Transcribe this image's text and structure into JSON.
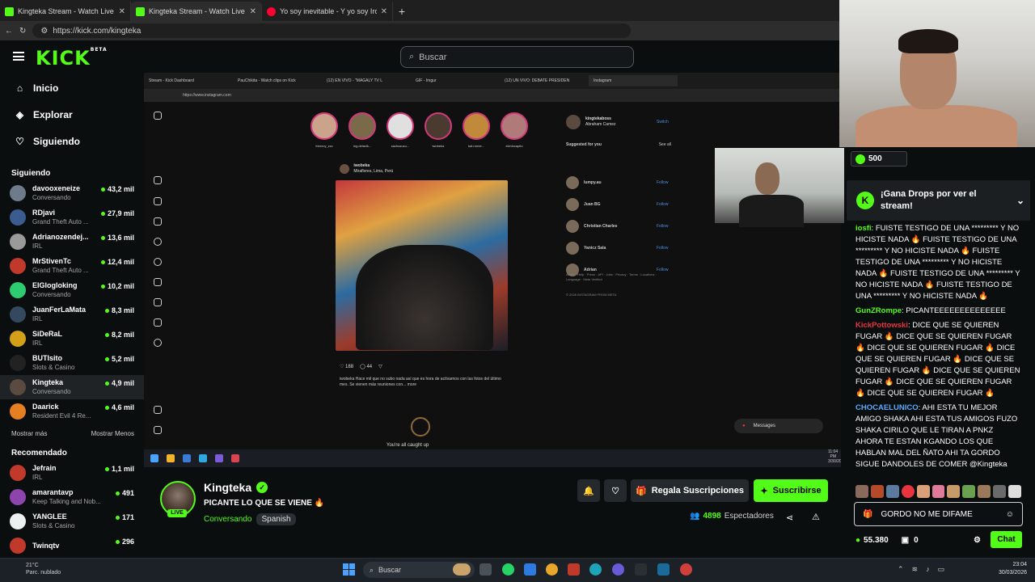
{
  "browser": {
    "tabs": [
      {
        "title": "Kingteka Stream - Watch Live on K",
        "icon": "kick-favicon",
        "color": "#53fc18"
      },
      {
        "title": "Kingteka Stream - Watch Live o",
        "icon": "kick-favicon",
        "color": "#53fc18"
      },
      {
        "title": "Yo soy inevitable - Y yo soy Iron M",
        "icon": "youtube-favicon",
        "color": "#ff0033"
      }
    ],
    "url": "https://kick.com/kingteka"
  },
  "kick": {
    "logo": "KICK",
    "logo_sup": "BETA",
    "search_placeholder": "Buscar",
    "nav": [
      {
        "label": "Inicio",
        "icon": "home-icon"
      },
      {
        "label": "Explorar",
        "icon": "compass-icon"
      },
      {
        "label": "Siguiendo",
        "icon": "heart-icon"
      }
    ],
    "following_header": "Siguiendo",
    "following": [
      {
        "name": "davooxeneize",
        "category": "Conversando",
        "viewers": "43,2 mil",
        "color": "#6f7b8a"
      },
      {
        "name": "RDjavi",
        "category": "Grand Theft Auto ...",
        "viewers": "27,9 mil",
        "color": "#3b5c8f"
      },
      {
        "name": "Adrianozendej...",
        "category": "IRL",
        "viewers": "13,6 mil",
        "color": "#9a9a9a"
      },
      {
        "name": "MrStivenTc",
        "category": "Grand Theft Auto ...",
        "viewers": "12,4 mil",
        "color": "#c0392b"
      },
      {
        "name": "ElGlogloking",
        "category": "Conversando",
        "viewers": "10,2 mil",
        "color": "#2ecc71"
      },
      {
        "name": "JuanFerLaMata",
        "category": "IRL",
        "viewers": "8,3 mil",
        "color": "#34495e"
      },
      {
        "name": "SiDeRaL",
        "category": "IRL",
        "viewers": "8,2 mil",
        "color": "#d4a017"
      },
      {
        "name": "BUTIsito",
        "category": "Slots & Casino",
        "viewers": "5,2 mil",
        "color": "#222"
      },
      {
        "name": "Kingteka",
        "category": "Conversando",
        "viewers": "4,9 mil",
        "color": "#5a4a40"
      },
      {
        "name": "Daarick",
        "category": "Resident Evil 4 Re...",
        "viewers": "4,6 mil",
        "color": "#e67e22"
      }
    ],
    "show_more": "Mostrar más",
    "show_less": "Mostrar Menos",
    "recommended_header": "Recomendado",
    "recommended": [
      {
        "name": "Jefrain",
        "category": "IRL",
        "viewers": "1,1 mil",
        "color": "#c0392b"
      },
      {
        "name": "amarantavp",
        "category": "Keep Talking and Nob...",
        "viewers": "491",
        "color": "#8e44ad"
      },
      {
        "name": "YANGLEE",
        "category": "Slots & Casino",
        "viewers": "171",
        "color": "#ecf0f1"
      },
      {
        "name": "Twinqtv",
        "category": "",
        "viewers": "296",
        "color": "#c0392b"
      }
    ]
  },
  "stream": {
    "inner_tabs": [
      "Stream - Kick Dashboard",
      "PauChikita - Watch clips on Kick",
      "(12) EN VIVO - \"MAGALY TV L",
      "GIF - Imgur",
      "(12) UN VIVO: DEBATE PRESIDEN",
      "Instagram"
    ],
    "inner_url": "https://www.instagram.com",
    "ig_post_user": "iwobeka",
    "ig_post_loc": "Miraflores, Lima, Perú",
    "ig_likes": "188",
    "ig_comments": "44",
    "ig_caption": "iwobeka Hace mil que no subo nada así que es hora de activarnos con las fotos del último mes. Se vienen más reuniones con... more",
    "ig_stories": [
      "frenecy_zzz",
      "mg.delacik...",
      "sachazuzu...",
      "iwobeka",
      "kat.romer...",
      "elchincapito"
    ],
    "ig_account": "kingtekaboss",
    "ig_account_name": "Abraham Camez",
    "ig_switch": "Switch",
    "ig_suggested": "Suggested for you",
    "ig_see_all": "See all",
    "ig_suggestions": [
      "lumpy.au",
      "Juan BG",
      "Christian Charles",
      "Yanicz Sala",
      "Adrian"
    ],
    "ig_follow": "Follow",
    "ig_footer": "About · Help · Press · API · Jobs · Privacy · Terms · Locations · Language · Meta Verified",
    "ig_copyright": "© 2026 INSTAGRAM FROM META",
    "ig_caught_up": "You're all caught up",
    "ig_messages": "Messages",
    "streamer": "Kingteka",
    "live": "LIVE",
    "title": "PICANTE LO QUE SE VIENE 🔥",
    "category": "Conversando",
    "language": "Spanish",
    "subscribe_gift": "Regala Suscripciones",
    "subscribe": "Suscribirse",
    "viewers_count": "4898",
    "viewers_label": "Espectadores"
  },
  "chat": {
    "coins": "500",
    "drops_text": "¡Gana Drops por ver el stream!",
    "messages": [
      {
        "user": "iosfi",
        "color": "#53fc18",
        "text": "FUISTE TESTIGO DE UNA ********* Y NO HICISTE NADA 🔥 FUISTE TESTIGO DE UNA ********* Y NO HICISTE NADA 🔥 FUISTE TESTIGO DE UNA ********* Y NO HICISTE NADA 🔥 FUISTE TESTIGO DE UNA ********* Y NO HICISTE NADA 🔥 FUISTE TESTIGO DE UNA ********* Y NO HICISTE NADA 🔥"
      },
      {
        "user": "GunZRompe",
        "color": "#53fc18",
        "text": "PICANTEEEEEEEEEEEEEE"
      },
      {
        "user": "KickPottowski",
        "color": "#e8343f",
        "text": "DICE QUE SE QUIEREN FUGAR 🔥 DICE QUE SE QUIEREN FUGAR 🔥 DICE QUE SE QUIEREN FUGAR 🔥 DICE QUE SE QUIEREN FUGAR 🔥 DICE QUE SE QUIEREN FUGAR 🔥 DICE QUE SE QUIEREN FUGAR 🔥 DICE QUE SE QUIEREN FUGAR 🔥 DICE QUE SE QUIEREN FUGAR 🔥"
      },
      {
        "user": "CHOCAELUNICO",
        "color": "#5aa9ff",
        "text": "AHI ESTA TU MEJOR AMIGO SHAKA AHI ESTA TUS AMIGOS FUZO SHAKA CIRILO QUE LE TIRAN A PNKZ AHORA TE ESTAN KGANDO LOS QUE HABLAN MAL DEL ÑATO AHI TA GORDO SIGUE DANDOLES DE COMER @Kingteka"
      }
    ],
    "input_value": "GORDO NO ME DIFAME",
    "balance": "55.380",
    "gifts": "0",
    "send": "Chat"
  },
  "taskbar": {
    "weather_temp": "21°C",
    "weather_desc": "Parc. nublado",
    "search": "Buscar",
    "time": "23:04",
    "date": "30/03/2026"
  },
  "stream_taskbar": {
    "time": "11:04 PM",
    "date": "3/30/2026"
  }
}
